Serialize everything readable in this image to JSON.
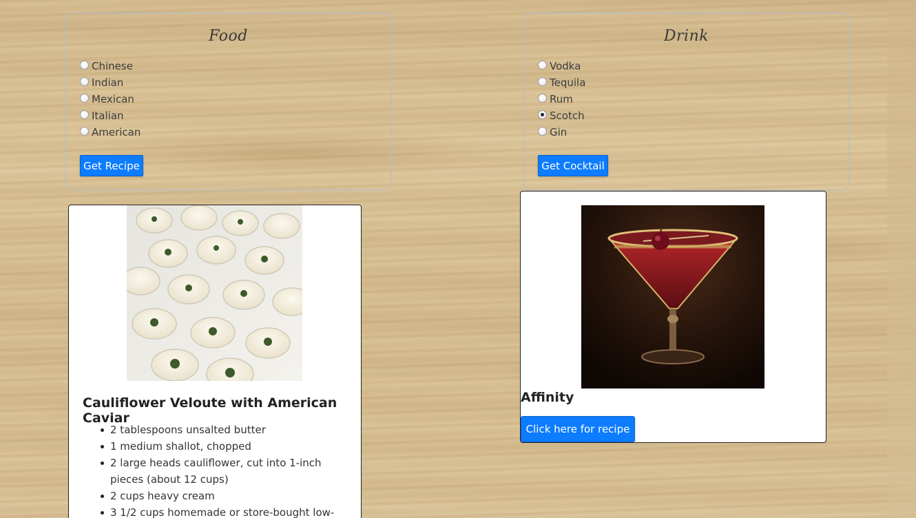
{
  "food": {
    "title": "Food",
    "options": [
      "Chinese",
      "Indian",
      "Mexican",
      "Italian",
      "American"
    ],
    "selected": null,
    "button_label": "Get Recipe"
  },
  "drink": {
    "title": "Drink",
    "options": [
      "Vodka",
      "Tequila",
      "Rum",
      "Scotch",
      "Gin"
    ],
    "selected": "Scotch",
    "button_label": "Get Cocktail"
  },
  "recipe": {
    "title": "Cauliflower Veloute with American Caviar",
    "ingredients": [
      "2 tablespoons unsalted butter",
      "1 medium shallot, chopped",
      "2 large heads cauliflower, cut into 1-inch pieces (about 12 cups)",
      "2 cups heavy cream",
      "3 1/2 cups homemade or store-bought low-"
    ]
  },
  "cocktail": {
    "name": "Affinity",
    "link_label": "Click here for recipe"
  },
  "colors": {
    "button": "#0d7cff",
    "card_border": "#222222"
  }
}
